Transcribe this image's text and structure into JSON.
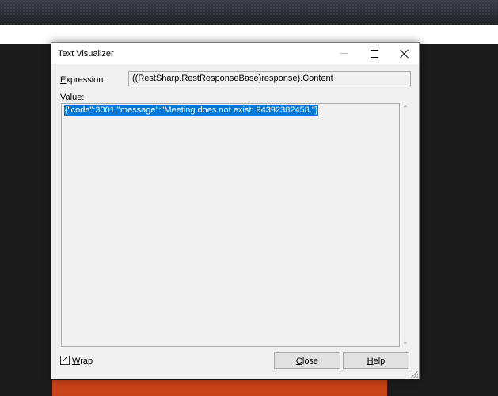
{
  "dialog": {
    "title": "Text Visualizer",
    "expression_label_prefix": "",
    "expression_label_accel": "E",
    "expression_label_rest": "xpression:",
    "expression_value": "((RestSharp.RestResponseBase)response).Content",
    "value_label_prefix": "",
    "value_label_accel": "V",
    "value_label_rest": "alue:",
    "value_text": "{\"code\":3001,\"message\":\"Meeting does not exist: 94392382458.\"}",
    "wrap_checked": true,
    "wrap_check_glyph": "✓",
    "wrap_label_accel": "W",
    "wrap_label_rest": "rap",
    "close_button_accel": "C",
    "close_button_rest": "lose",
    "help_button_accel": "H",
    "help_button_rest": "elp",
    "scroll_up_glyph": "⌃",
    "scroll_down_glyph": "⌄"
  },
  "colors": {
    "selection": "#0078d7",
    "background_accent": "#c9431a"
  }
}
